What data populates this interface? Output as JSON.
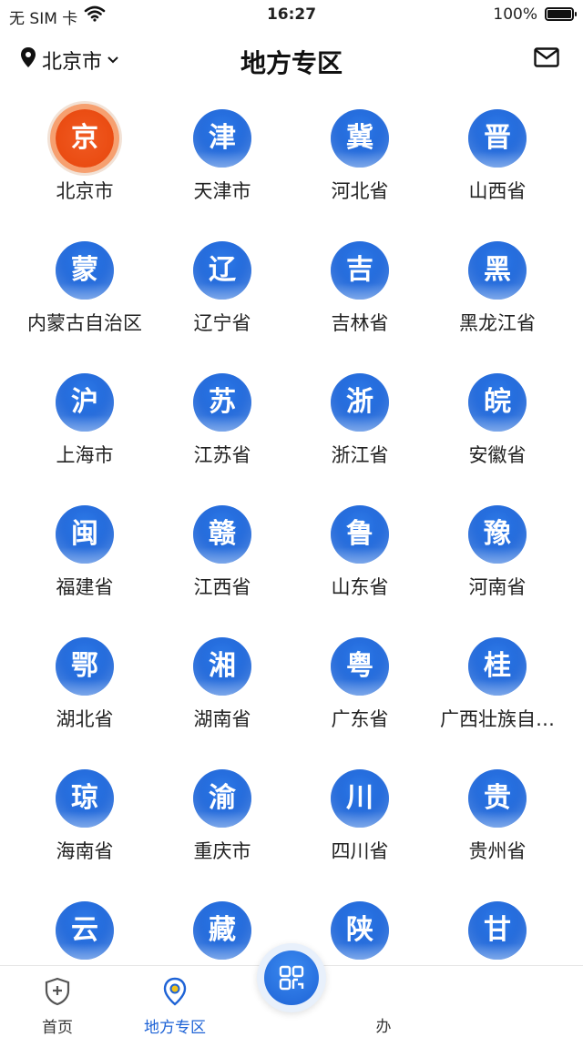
{
  "status_bar": {
    "carrier": "无 SIM 卡",
    "time": "16:27",
    "battery": "100%"
  },
  "nav": {
    "location": "北京市",
    "title": "地方专区"
  },
  "regions": [
    {
      "glyph": "京",
      "name": "北京市"
    },
    {
      "glyph": "津",
      "name": "天津市"
    },
    {
      "glyph": "冀",
      "name": "河北省"
    },
    {
      "glyph": "晋",
      "name": "山西省"
    },
    {
      "glyph": "蒙",
      "name": "内蒙古自治区"
    },
    {
      "glyph": "辽",
      "name": "辽宁省"
    },
    {
      "glyph": "吉",
      "name": "吉林省"
    },
    {
      "glyph": "黑",
      "name": "黑龙江省"
    },
    {
      "glyph": "沪",
      "name": "上海市"
    },
    {
      "glyph": "苏",
      "name": "江苏省"
    },
    {
      "glyph": "浙",
      "name": "浙江省"
    },
    {
      "glyph": "皖",
      "name": "安徽省"
    },
    {
      "glyph": "闽",
      "name": "福建省"
    },
    {
      "glyph": "赣",
      "name": "江西省"
    },
    {
      "glyph": "鲁",
      "name": "山东省"
    },
    {
      "glyph": "豫",
      "name": "河南省"
    },
    {
      "glyph": "鄂",
      "name": "湖北省"
    },
    {
      "glyph": "湘",
      "name": "湖南省"
    },
    {
      "glyph": "粤",
      "name": "广东省"
    },
    {
      "glyph": "桂",
      "name": "广西壮族自…"
    },
    {
      "glyph": "琼",
      "name": "海南省"
    },
    {
      "glyph": "渝",
      "name": "重庆市"
    },
    {
      "glyph": "川",
      "name": "四川省"
    },
    {
      "glyph": "贵",
      "name": "贵州省"
    },
    {
      "glyph": "云",
      "name": ""
    },
    {
      "glyph": "藏",
      "name": ""
    },
    {
      "glyph": "陕",
      "name": ""
    },
    {
      "glyph": "甘",
      "name": ""
    }
  ],
  "tabs": [
    {
      "label": "首页",
      "icon": "shield-plus-icon"
    },
    {
      "label": "地方专区",
      "icon": "location-pin-icon"
    },
    {
      "label": "办",
      "icon": "task-icon"
    }
  ],
  "colors": {
    "accent": "#1e63d6",
    "beijing": "#ea4c12"
  }
}
